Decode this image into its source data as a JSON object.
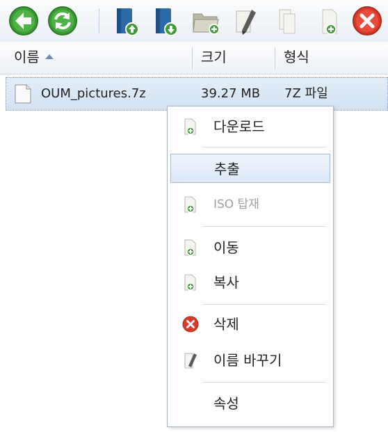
{
  "toolbar": {
    "buttons": [
      {
        "icon": "back-arrow-icon"
      },
      {
        "icon": "refresh-icon"
      },
      {
        "icon": "upload-icon"
      },
      {
        "icon": "download-icon"
      },
      {
        "icon": "new-folder-icon"
      },
      {
        "icon": "rename-icon"
      },
      {
        "icon": "copy-icon"
      },
      {
        "icon": "new-file-icon"
      },
      {
        "icon": "delete-icon"
      }
    ],
    "colors": {
      "green": "#3d9b35",
      "blue": "#2c6aa7",
      "red": "#d83a2c"
    }
  },
  "columns": {
    "name": "이름",
    "size": "크기",
    "type": "형식"
  },
  "files": [
    {
      "name": "OUM_pictures.7z",
      "size": "39.27 MB",
      "type": "7Z 파일"
    }
  ],
  "context_menu": {
    "items": [
      {
        "label": "다운로드",
        "icon": "download-doc-icon"
      },
      {
        "label": "추출",
        "selected": true
      },
      {
        "label": "ISO 탑재",
        "icon": "mount-doc-icon",
        "disabled": true
      },
      {
        "label": "이동",
        "icon": "move-doc-icon"
      },
      {
        "label": "복사",
        "icon": "copy-doc-icon"
      },
      {
        "label": "삭제",
        "icon": "delete-icon"
      },
      {
        "label": "이름 바꾸기",
        "icon": "rename-icon"
      },
      {
        "label": "속성"
      }
    ]
  }
}
